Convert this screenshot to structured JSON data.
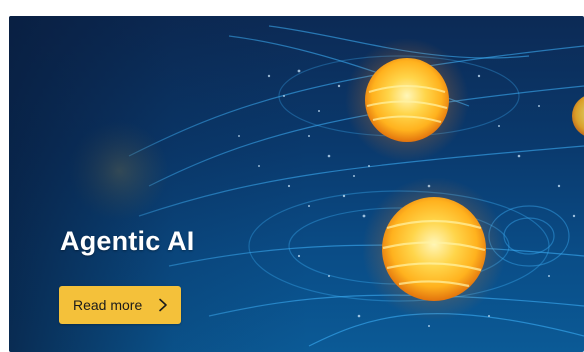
{
  "hero": {
    "title": "Agentic AI",
    "image_icon": "quantum-orbs-illustration",
    "colors": {
      "background_dark": "#0c2a55",
      "background_mid": "#0a4c86",
      "orb_core": "#ffd54a",
      "orb_glow": "#ff9a1f",
      "streams": "#3fb6ff"
    }
  },
  "cta": {
    "label": "Read more",
    "icon": "chevron-right-icon",
    "color": "#f4c13a"
  }
}
